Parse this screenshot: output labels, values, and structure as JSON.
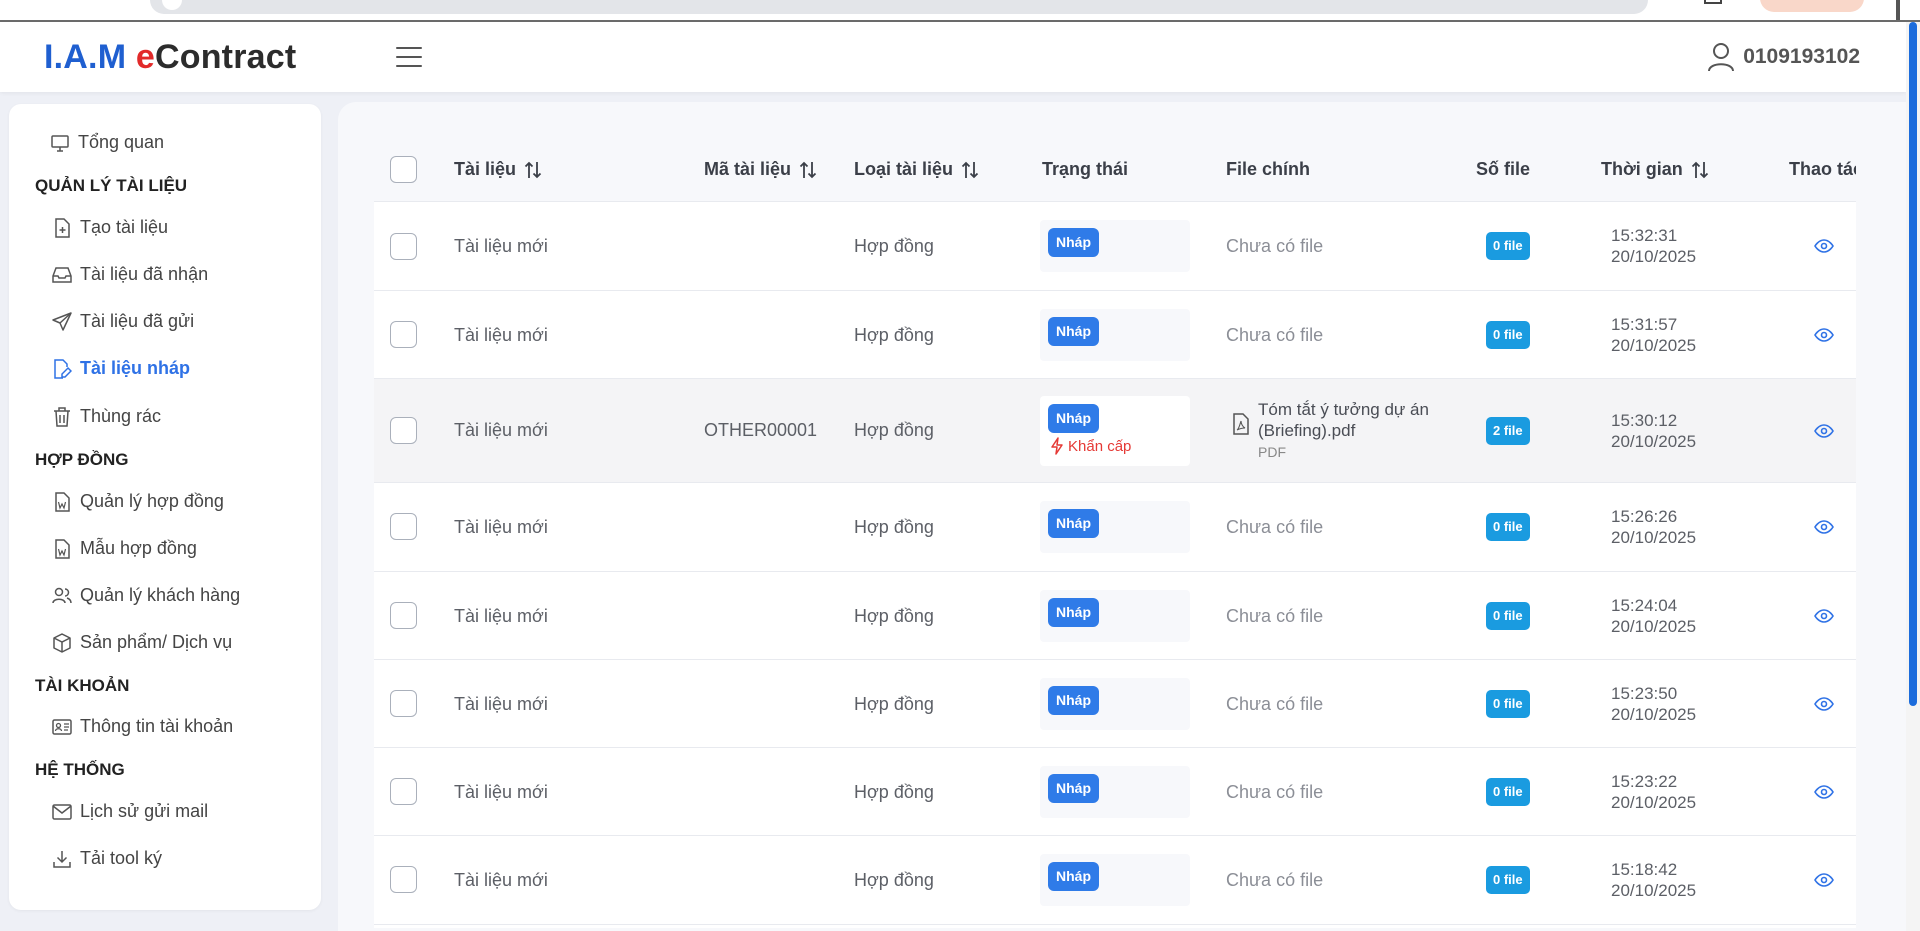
{
  "header": {
    "logo": {
      "part1": "I.A.M ",
      "part2": "e",
      "part3": "Contract"
    },
    "user_label": "0109193102"
  },
  "sidebar": {
    "overview": "Tổng quan",
    "sections": [
      {
        "title": "QUẢN LÝ TÀI LIỆU",
        "items": [
          {
            "label": "Tạo tài liệu",
            "icon": "file-plus-icon"
          },
          {
            "label": "Tài liệu đã nhận",
            "icon": "inbox-icon"
          },
          {
            "label": "Tài liệu đã gửi",
            "icon": "send-icon"
          },
          {
            "label": "Tài liệu nháp",
            "icon": "file-edit-icon",
            "active": true
          },
          {
            "label": "Thùng rác",
            "icon": "trash-icon"
          }
        ]
      },
      {
        "title": "HỢP ĐỒNG",
        "items": [
          {
            "label": "Quản lý hợp đồng",
            "icon": "file-word-icon"
          },
          {
            "label": "Mẫu hợp đồng",
            "icon": "file-word-icon"
          },
          {
            "label": "Quản lý khách hàng",
            "icon": "users-icon"
          },
          {
            "label": "Sản phẩm/ Dịch vụ",
            "icon": "box-icon"
          }
        ]
      },
      {
        "title": "TÀI KHOẢN",
        "items": [
          {
            "label": "Thông tin tài khoản",
            "icon": "id-card-icon"
          }
        ]
      },
      {
        "title": "HỆ THỐNG",
        "items": [
          {
            "label": "Lịch sử gửi mail",
            "icon": "mail-icon"
          },
          {
            "label": "Tải tool ký",
            "icon": "download-icon"
          }
        ]
      }
    ]
  },
  "table": {
    "columns": {
      "document": "Tài liệu",
      "code": "Mã tài liệu",
      "type": "Loại tài liệu",
      "status": "Trạng thái",
      "main_file": "File chính",
      "file_count": "Số file",
      "time": "Thời gian",
      "actions": "Thao tác"
    },
    "rows": [
      {
        "document": "Tài liệu mới",
        "code": "",
        "type": "Hợp đồng",
        "status": "Nháp",
        "main_file": "Chưa có file",
        "file_count": "0 file",
        "time": "15:32:31",
        "date": "20/10/2025"
      },
      {
        "document": "Tài liệu mới",
        "code": "",
        "type": "Hợp đồng",
        "status": "Nháp",
        "main_file": "Chưa có file",
        "file_count": "0 file",
        "time": "15:31:57",
        "date": "20/10/2025"
      },
      {
        "document": "Tài liệu mới",
        "code": "OTHER00001",
        "type": "Hợp đồng",
        "status": "Nháp",
        "urgent": "Khẩn cấp",
        "main_file_name": "Tóm tắt ý tưởng dự án (Briefing).pdf",
        "main_file_type": "PDF",
        "file_count": "2 file",
        "time": "15:30:12",
        "date": "20/10/2025"
      },
      {
        "document": "Tài liệu mới",
        "code": "",
        "type": "Hợp đồng",
        "status": "Nháp",
        "main_file": "Chưa có file",
        "file_count": "0 file",
        "time": "15:26:26",
        "date": "20/10/2025"
      },
      {
        "document": "Tài liệu mới",
        "code": "",
        "type": "Hợp đồng",
        "status": "Nháp",
        "main_file": "Chưa có file",
        "file_count": "0 file",
        "time": "15:24:04",
        "date": "20/10/2025"
      },
      {
        "document": "Tài liệu mới",
        "code": "",
        "type": "Hợp đồng",
        "status": "Nháp",
        "main_file": "Chưa có file",
        "file_count": "0 file",
        "time": "15:23:50",
        "date": "20/10/2025"
      },
      {
        "document": "Tài liệu mới",
        "code": "",
        "type": "Hợp đồng",
        "status": "Nháp",
        "main_file": "Chưa có file",
        "file_count": "0 file",
        "time": "15:23:22",
        "date": "20/10/2025"
      },
      {
        "document": "Tài liệu mới",
        "code": "",
        "type": "Hợp đồng",
        "status": "Nháp",
        "main_file": "Chưa có file",
        "file_count": "0 file",
        "time": "15:18:42",
        "date": "20/10/2025"
      }
    ]
  },
  "colors": {
    "accent": "#2f72e6",
    "badge_draft": "#2f7be8",
    "badge_file": "#1a9be0",
    "urgent": "#e53935",
    "logo_blue": "#1f5fd0",
    "logo_red": "#e22a2a"
  }
}
